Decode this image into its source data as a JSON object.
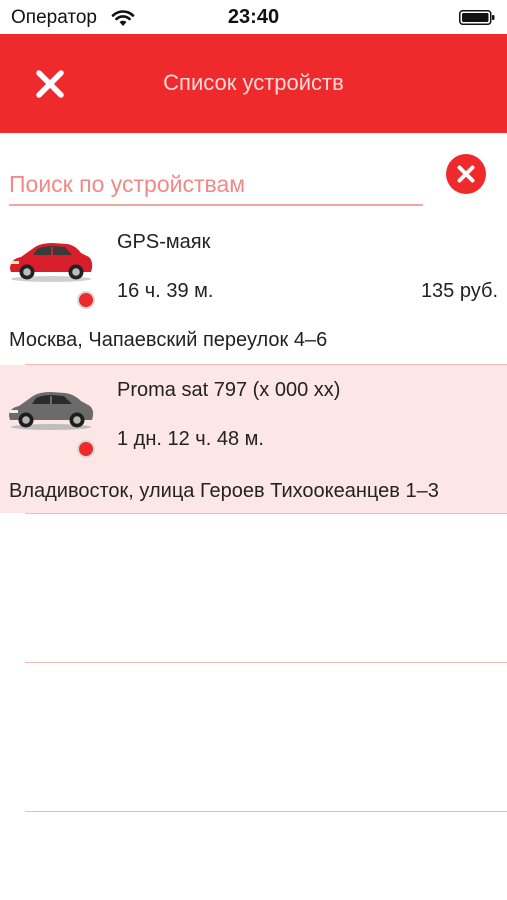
{
  "status_bar": {
    "carrier": "Оператор",
    "time": "23:40"
  },
  "header": {
    "title": "Список устройств"
  },
  "search": {
    "placeholder": "Поиск по устройствам"
  },
  "devices": [
    {
      "name": "GPS-маяк",
      "duration": "16 ч. 39 м.",
      "price": "135 руб.",
      "address": "Москва, Чапаевский переулок 4–6",
      "car_color": "#d81e2a",
      "status_color": "#ee2a2c"
    },
    {
      "name": "Proma sat 797 (x 000 xx)",
      "duration": "1 дн. 12 ч. 48 м.",
      "price": "",
      "address": "Владивосток, улица Героев Тихоокеанцев 1–3",
      "car_color": "#6b6b6b",
      "status_color": "#ee2a2c"
    }
  ],
  "colors": {
    "accent": "#ee2a2c",
    "highlight_row": "#fde7e6",
    "separator": "#f2b8b6"
  }
}
